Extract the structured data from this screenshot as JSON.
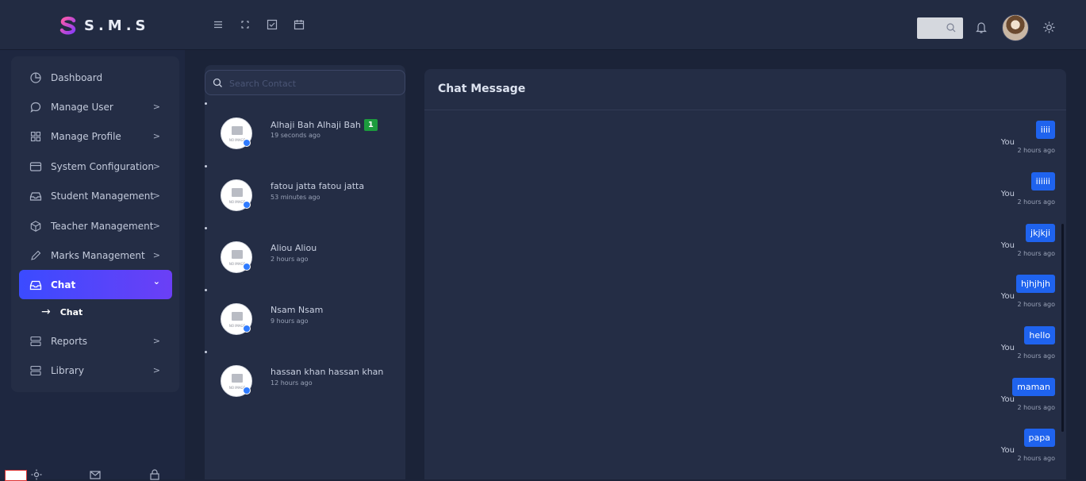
{
  "app": {
    "name": "S.M.S"
  },
  "colors": {
    "accent": "#3b4bff",
    "accent2": "#6b3ff6",
    "bubble": "#1f63ee",
    "badge": "#1c9b3d",
    "online": "#2f7bff"
  },
  "topbar": {
    "tools": [
      "menu-icon",
      "fullscreen-icon",
      "task-check-icon",
      "calendar-icon"
    ],
    "search": {
      "placeholder": ""
    }
  },
  "sidebar": {
    "items": [
      {
        "label": "Dashboard",
        "icon": "pie-chart-icon"
      },
      {
        "label": "Manage User",
        "icon": "chat-bubble-icon",
        "chevron": ">"
      },
      {
        "label": "Manage Profile",
        "icon": "grid-icon",
        "chevron": ">"
      },
      {
        "label": "System Configuration",
        "icon": "card-icon",
        "chevron": ">"
      },
      {
        "label": "Student Management",
        "icon": "tray-icon",
        "chevron": ">"
      },
      {
        "label": "Teacher Management",
        "icon": "box-icon",
        "chevron": ">"
      },
      {
        "label": "Marks Management",
        "icon": "pen-icon",
        "chevron": ">"
      },
      {
        "label": "Chat",
        "icon": "inbox-icon",
        "chevron": "⌄",
        "active": true
      },
      {
        "label": "Reports",
        "icon": "server-icon",
        "chevron": ">"
      },
      {
        "label": "Library",
        "icon": "server-icon",
        "chevron": ">"
      }
    ],
    "sub_item": {
      "label": "Chat",
      "arrow": "→"
    }
  },
  "contacts": {
    "search_placeholder": "Search Contact",
    "avatar_text": "NO IMAGE",
    "list": [
      {
        "name": "Alhaji Bah Alhaji Bah",
        "time": "19 seconds ago",
        "badge": "1"
      },
      {
        "name": "fatou jatta fatou jatta",
        "time": "53 minutes ago"
      },
      {
        "name": "Aliou Aliou",
        "time": "2 hours ago"
      },
      {
        "name": "Nsam Nsam",
        "time": "9 hours ago"
      },
      {
        "name": "hassan khan hassan khan",
        "time": "12 hours ago"
      }
    ]
  },
  "chat": {
    "title": "Chat Message",
    "messages": [
      {
        "text": "iiii",
        "sender": "You",
        "time": "2 hours ago"
      },
      {
        "text": "iiiiii",
        "sender": "You",
        "time": "2 hours ago"
      },
      {
        "text": "jkjkji",
        "sender": "You",
        "time": "2 hours ago"
      },
      {
        "text": "hjhjhjh",
        "sender": "You",
        "time": "2 hours ago"
      },
      {
        "text": "hello",
        "sender": "You",
        "time": "2 hours ago"
      },
      {
        "text": "maman",
        "sender": "You",
        "time": "2 hours ago"
      },
      {
        "text": "papa",
        "sender": "You",
        "time": "2 hours ago"
      }
    ]
  }
}
